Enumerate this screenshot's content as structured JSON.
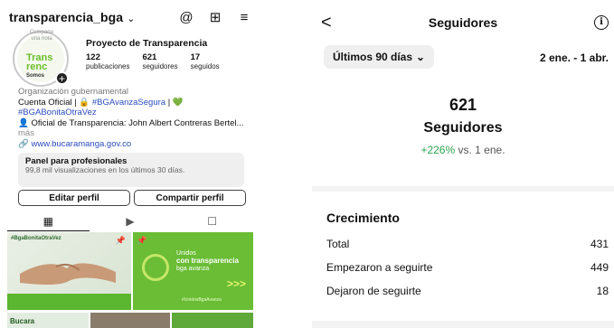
{
  "profile": {
    "username": "transparencia_bga",
    "note_text": "Comparte una nota",
    "name": "Proyecto de Transparencia",
    "stats": [
      {
        "value": "122",
        "label": "publicaciones"
      },
      {
        "value": "621",
        "label": "seguidores"
      },
      {
        "value": "17",
        "label": "seguidos"
      }
    ],
    "bio": {
      "category": "Organización gubernamental",
      "line1_prefix": "Cuenta Oficial | 🔒 ",
      "hashtag1": "#BGAvanzaSegura",
      "line1_suffix": " | ",
      "heart": "💚",
      "hashtag2": "#BGABonitaOtraVez",
      "line3": "👤 Oficial de Transparencia: John Albert Contreras Bertel...",
      "more": " más",
      "link_icon": "🔗",
      "link": "www.bucaramanga.gov.co"
    },
    "panel": {
      "title": "Panel para profesionales",
      "subtitle": "99,8 mil visualizaciones en los últimos 30 días."
    },
    "buttons": {
      "edit": "Editar perfil",
      "share": "Compartir perfil"
    },
    "posts": {
      "post1_tag": "#BgaBonitaOtraVez",
      "post2_line1": "Unidos",
      "post2_line2": "con transparencia",
      "post2_line3": "bga avanza",
      "post2_arrows": ">>>",
      "post2_foot": "#UnidosBgaAvanza",
      "post3_text": "Bucara"
    },
    "icons": {
      "chevron": "⌄",
      "threads": "@",
      "add": "⊞",
      "menu": "≡",
      "grid": "▦",
      "reels": "▶",
      "tagged": "☐",
      "pin": "📌"
    }
  },
  "followers": {
    "title": "Seguidores",
    "back_glyph": "<",
    "info_glyph": "i",
    "filter_label": "Últimos 90 días",
    "filter_chevron": "⌄",
    "date_range": "2 ene. - 1 abr.",
    "total_count": "621",
    "total_label": "Seguidores",
    "change_pct": "+226%",
    "change_ref": " vs. 1 ene.",
    "growth_section": {
      "title": "Crecimiento",
      "rows": [
        {
          "label": "Total",
          "value": "431"
        },
        {
          "label": "Empezaron a seguirte",
          "value": "449"
        },
        {
          "label": "Dejaron de seguirte",
          "value": "18"
        }
      ]
    }
  }
}
